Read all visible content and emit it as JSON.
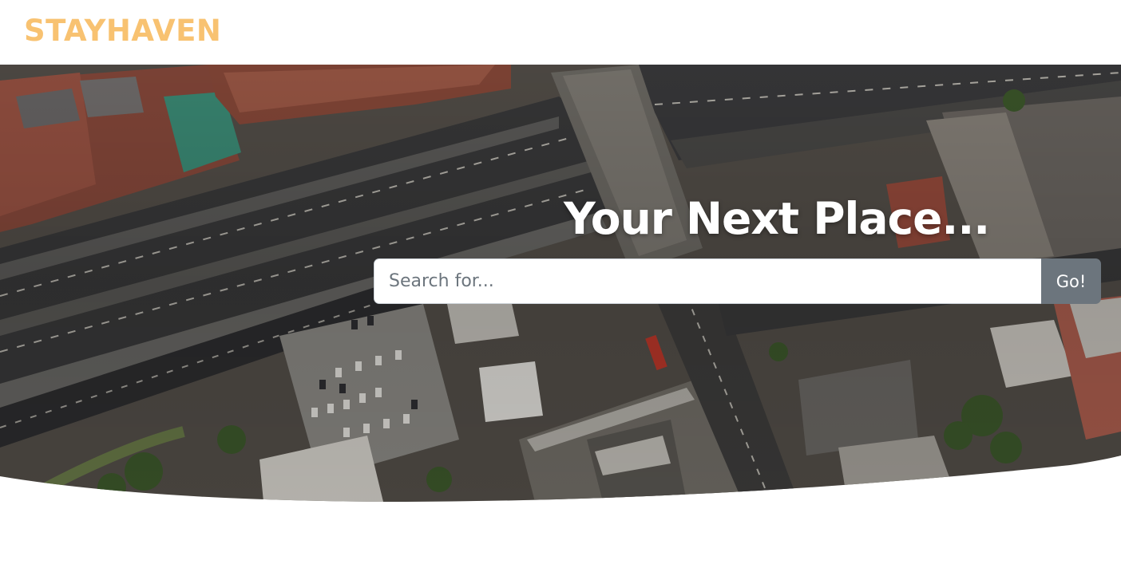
{
  "navbar": {
    "brand": "STAYHAVEN"
  },
  "hero": {
    "title": "Your Next Place...",
    "search": {
      "placeholder": "Search for...",
      "value": "",
      "button_label": "Go!"
    }
  },
  "colors": {
    "brand": "#f8c271",
    "button": "#6c757d",
    "page_background": "#ffffff"
  }
}
